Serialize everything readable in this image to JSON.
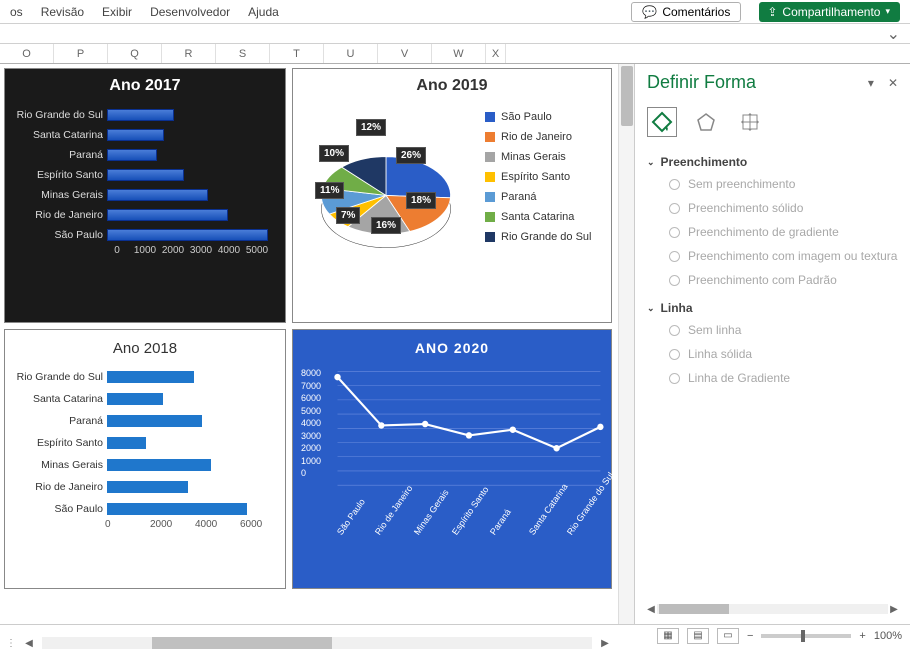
{
  "menu": {
    "items": [
      "os",
      "Revisão",
      "Exibir",
      "Desenvolvedor",
      "Ajuda"
    ],
    "comments": "Comentários",
    "share": "Compartilhamento"
  },
  "cols": [
    "O",
    "P",
    "Q",
    "R",
    "S",
    "T",
    "U",
    "V",
    "W",
    "X"
  ],
  "panel": {
    "title": "Definir Forma",
    "section_fill": "Preenchimento",
    "fill_opts": [
      "Sem preenchimento",
      "Preenchimento sólido",
      "Preenchimento de gradiente",
      "Preenchimento com imagem ou textura",
      "Preenchimento com Padrão"
    ],
    "section_line": "Linha",
    "line_opts": [
      "Sem linha",
      "Linha sólida",
      "Linha de Gradiente"
    ]
  },
  "status": {
    "zoom": "100%"
  },
  "chart_data": [
    {
      "id": "ano2017",
      "type": "bar",
      "orientation": "horizontal",
      "title": "Ano 2017",
      "categories": [
        "Rio Grande do Sul",
        "Santa Catarina",
        "Paraná",
        "Espírito Santo",
        "Minas Gerais",
        "Rio de Janeiro",
        "São Paulo"
      ],
      "values": [
        2000,
        1700,
        1500,
        2300,
        3000,
        3600,
        4800
      ],
      "xlim": [
        0,
        5000
      ],
      "xticks": [
        0,
        1000,
        2000,
        3000,
        4000,
        5000
      ]
    },
    {
      "id": "ano2019",
      "type": "pie",
      "title": "Ano 2019",
      "series": [
        {
          "name": "São Paulo",
          "value": 26,
          "color": "#2a5dc7"
        },
        {
          "name": "Rio de Janeiro",
          "value": 18,
          "color": "#ed7d31"
        },
        {
          "name": "Minas Gerais",
          "value": 16,
          "color": "#a5a5a5"
        },
        {
          "name": "Espírito Santo",
          "value": 7,
          "color": "#ffc000"
        },
        {
          "name": "Paraná",
          "value": 11,
          "color": "#5b9bd5"
        },
        {
          "name": "Santa Catarina",
          "value": 10,
          "color": "#70ad47"
        },
        {
          "name": "Rio Grande do Sul",
          "value": 12,
          "color": "#1f3864"
        }
      ]
    },
    {
      "id": "ano2018",
      "type": "bar",
      "orientation": "horizontal",
      "title": "Ano 2018",
      "categories": [
        "Rio Grande do Sul",
        "Santa Catarina",
        "Paraná",
        "Espírito Santo",
        "Minas Gerais",
        "Rio de Janeiro",
        "São Paulo"
      ],
      "values": [
        3100,
        2000,
        3400,
        1400,
        3700,
        2900,
        5000
      ],
      "xlim": [
        0,
        6000
      ],
      "xticks": [
        0,
        2000,
        4000,
        6000
      ]
    },
    {
      "id": "ano2020",
      "type": "line",
      "title": "ANO 2020",
      "categories": [
        "São Paulo",
        "Rio de Janeiro",
        "Minas Gerais",
        "Espírito Santo",
        "Paraná",
        "Santa Catarina",
        "Rio Grande do Sul"
      ],
      "values": [
        7600,
        4200,
        4300,
        3500,
        3900,
        2600,
        4100
      ],
      "ylim": [
        0,
        8000
      ],
      "yticks": [
        0,
        1000,
        2000,
        3000,
        4000,
        5000,
        6000,
        7000,
        8000
      ]
    }
  ]
}
